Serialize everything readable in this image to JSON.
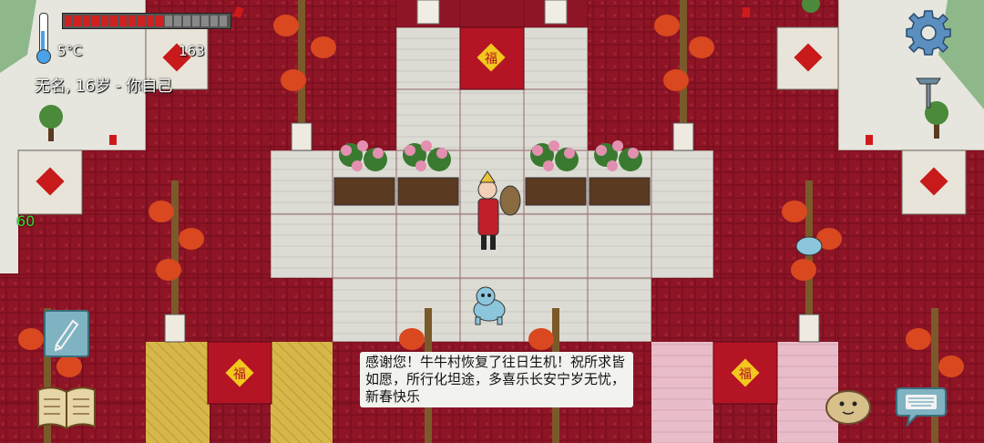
{
  "hud": {
    "temperature": "5°C",
    "food_value": "163",
    "player_info": "无名, 16岁 - 你自己",
    "yum_counter": "60"
  },
  "dialog": {
    "message": "感谢您！牛牛村恢复了往日生机！祝所求皆如愿，所行化坦途，多喜乐长安宁岁无忧，新春快乐"
  },
  "colors": {
    "carpet_red": "#8e1526",
    "stone_white": "#ddddd6",
    "straw_yellow": "#d8b84a",
    "pink_floor": "#e6b8c4",
    "lantern": "#d9481f",
    "hud_green": "#33dd33"
  },
  "icons": [
    "thermometer-icon",
    "settings-gear-icon",
    "pickaxe-icon",
    "pen-icon",
    "recipe-book-icon",
    "emote-potato-icon",
    "keyboard-icon"
  ]
}
